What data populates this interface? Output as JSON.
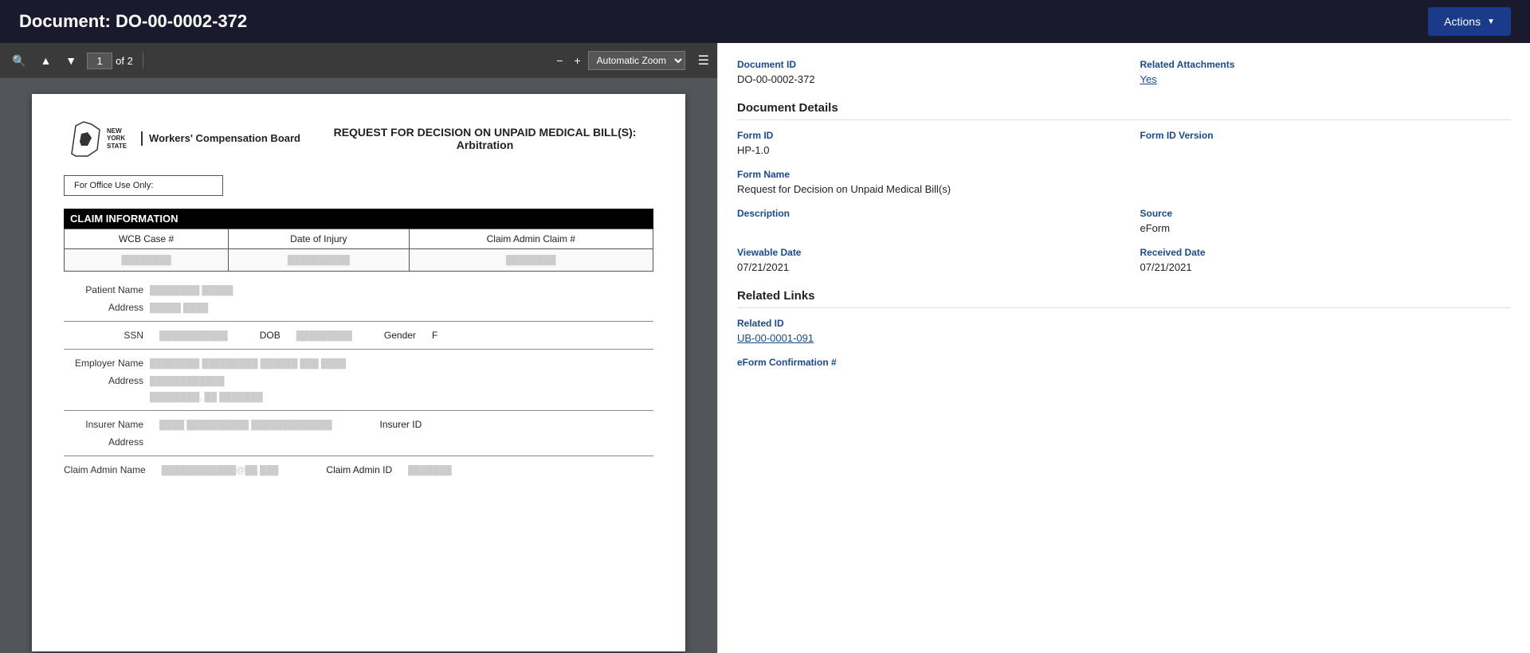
{
  "header": {
    "title": "Document: DO-00-0002-372",
    "actions_label": "Actions",
    "actions_chevron": "▼"
  },
  "pdf_toolbar": {
    "page_current": "1",
    "page_total": "of 2",
    "zoom_label": "Automatic Zoom"
  },
  "pdf_document": {
    "state_name": "NEW YORK STATE",
    "board_name": "Workers' Compensation Board",
    "doc_title": "REQUEST FOR DECISION ON UNPAID MEDICAL BILL(S): Arbitration",
    "office_use_label": "For Office Use Only:",
    "claim_info_header": "CLAIM INFORMATION",
    "table_headers": [
      "WCB Case #",
      "Date of Injury",
      "Claim Admin Claim #"
    ],
    "table_values": [
      "[redacted]",
      "[redacted]",
      "[redacted]"
    ],
    "patient_name_label": "Patient Name",
    "patient_name_value": "[redacted name]",
    "address_label": "Address",
    "patient_address_value": "[redacted addr]",
    "ssn_label": "SSN",
    "ssn_value": "[redacted]",
    "dob_label": "DOB",
    "dob_value": "[redacted]",
    "gender_label": "Gender",
    "gender_value": "F",
    "employer_name_label": "Employer Name",
    "employer_name_value": "[redacted employer name, addr line]",
    "employer_address_label": "Address",
    "employer_address_1": "[redacted addr1]",
    "employer_address_2": "[redacted, st zipcode]",
    "insurer_name_label": "Insurer Name",
    "insurer_name_value": "[redacted insurer name]",
    "insurer_id_label": "Insurer ID",
    "insurer_id_value": "",
    "insurer_address_label": "Address",
    "claim_admin_name_label": "Claim Admin Name",
    "claim_admin_name_value": "[redacted@example.com]",
    "claim_admin_id_label": "Claim Admin ID",
    "claim_admin_id_value": "[redacted]"
  },
  "metadata": {
    "document_id_label": "Document ID",
    "document_id_value": "DO-00-0002-372",
    "related_attachments_label": "Related Attachments",
    "related_attachments_value": "Yes",
    "document_details_title": "Document Details",
    "form_id_label": "Form ID",
    "form_id_value": "HP-1.0",
    "form_id_version_label": "Form ID Version",
    "form_id_version_value": "",
    "form_name_label": "Form Name",
    "form_name_value": "Request for Decision on Unpaid Medical Bill(s)",
    "description_label": "Description",
    "description_value": "",
    "source_label": "Source",
    "source_value": "eForm",
    "viewable_date_label": "Viewable Date",
    "viewable_date_value": "07/21/2021",
    "received_date_label": "Received Date",
    "received_date_value": "07/21/2021",
    "related_links_title": "Related Links",
    "related_id_label": "Related ID",
    "related_id_value": "UB-00-0001-091",
    "eform_confirmation_label": "eForm Confirmation #",
    "eform_confirmation_value": ""
  }
}
